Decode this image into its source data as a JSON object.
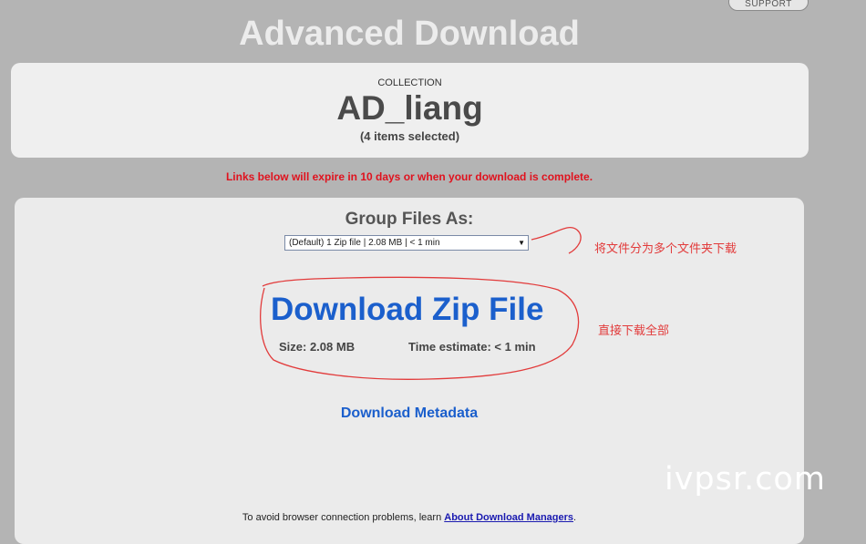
{
  "header": {
    "support_label": "SUPPORT",
    "title": "Advanced Download"
  },
  "collection": {
    "label": "COLLECTION",
    "name": "AD_liang",
    "items_selected": "(4 items selected)"
  },
  "expire_notice": "Links below will expire in 10 days or when your download is complete.",
  "group_files": {
    "heading": "Group Files As:",
    "selected_option": "(Default) 1 Zip file | 2.08 MB | < 1 min"
  },
  "download": {
    "zip_label": "Download Zip File",
    "size_text": "Size: 2.08 MB",
    "time_text": "Time estimate: < 1 min",
    "metadata_label": "Download Metadata"
  },
  "footer": {
    "prefix": "To avoid browser connection problems, learn ",
    "link_label": "About Download Managers",
    "suffix": "."
  },
  "annotations": {
    "split_note": "将文件分为多个文件夹下载",
    "direct_note": "直接下载全部",
    "ink_color": "#e23b3b"
  },
  "watermark": "ivpsr.com",
  "colors": {
    "link_blue": "#1b5fcc",
    "notice_red": "#e0121e",
    "background": "#b4b4b4"
  }
}
